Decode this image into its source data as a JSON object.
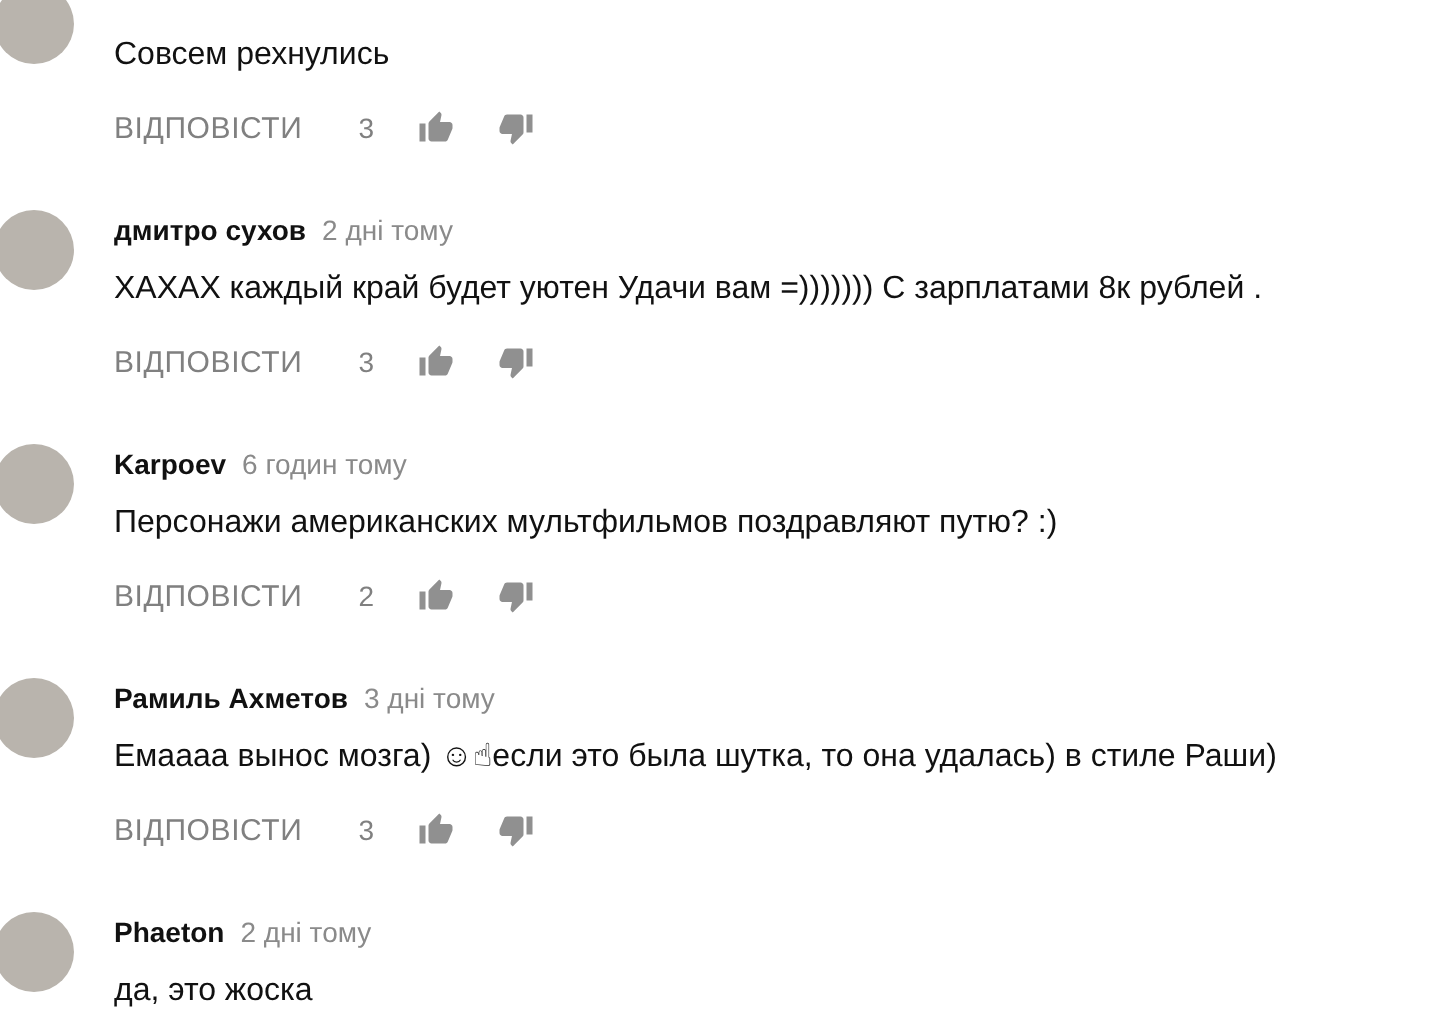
{
  "comments": [
    {
      "text": "Совсем рехнулись",
      "reply": "ВІДПОВІСТИ",
      "likes": "3"
    },
    {
      "author": "дмитро сухов",
      "time": "2 дні тому",
      "text": "ХАХАХ каждый край будет уютен Удачи вам  =))))))) С зарплатами 8к рублей .",
      "reply": "ВІДПОВІСТИ",
      "likes": "3"
    },
    {
      "author": "Karpoev",
      "time": "6 годин тому",
      "text": "Персонажи американских мультфильмов поздравляют путю? :)",
      "reply": "ВІДПОВІСТИ",
      "likes": "2"
    },
    {
      "author": "Рамиль Ахметов",
      "time": "3 дні тому",
      "text": "Емаааа вынос мозга) ☺☝если это была шутка, то она удалась) в стиле Раши)",
      "reply": "ВІДПОВІСТИ",
      "likes": "3"
    },
    {
      "author": "Phaeton",
      "time": "2 дні тому",
      "text": "да, это жоска"
    }
  ]
}
